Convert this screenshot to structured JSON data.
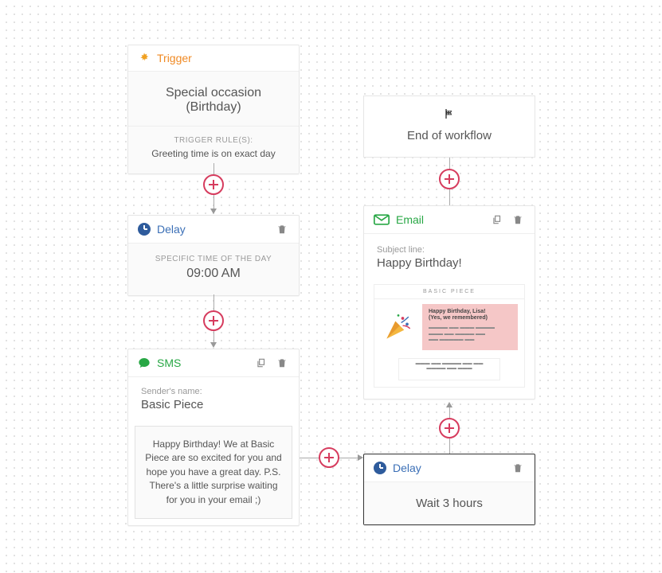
{
  "trigger": {
    "title": "Trigger",
    "body": "Special occasion (Birthday)",
    "rules_label": "TRIGGER RULE(S):",
    "rule1": "Greeting time is on exact day"
  },
  "delay1": {
    "title": "Delay",
    "sub": "SPECIFIC TIME OF THE DAY",
    "time": "09:00 AM"
  },
  "sms": {
    "title": "SMS",
    "sender_label": "Sender's name:",
    "sender": "Basic Piece",
    "message": "Happy Birthday! We at Basic Piece are so excited for you and hope you have a great day. P.S. There's a little surprise waiting for you in your email ;)"
  },
  "delay2": {
    "title": "Delay",
    "body": "Wait 3 hours"
  },
  "email": {
    "title": "Email",
    "subject_label": "Subject line:",
    "subject": "Happy Birthday!",
    "preview_brand": "BASIC PIECE",
    "preview_head1": "Happy Birthday, Lisa!",
    "preview_head2": "(Yes, we remembered)"
  },
  "end": {
    "label": "End of workflow"
  }
}
